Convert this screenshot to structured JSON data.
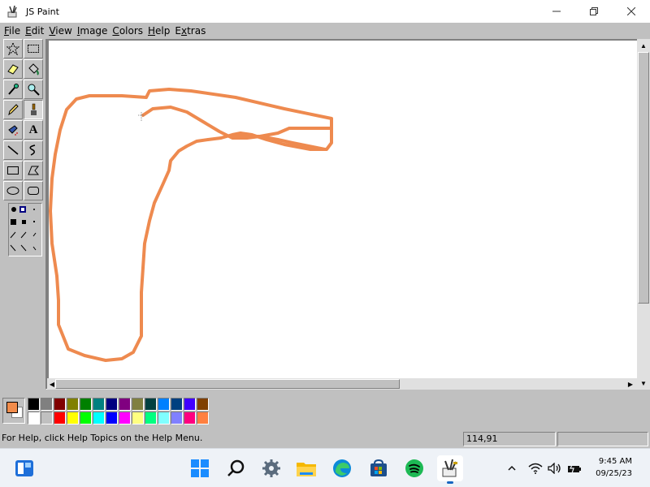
{
  "window": {
    "title": "JS Paint",
    "minimize_icon": "minimize-icon",
    "maximize_icon": "restore-icon",
    "close_icon": "close-icon"
  },
  "menu": [
    {
      "label": "File",
      "mnemonic": "F",
      "rest": "ile"
    },
    {
      "label": "Edit",
      "mnemonic": "E",
      "rest": "dit"
    },
    {
      "label": "View",
      "mnemonic": "V",
      "rest": "iew"
    },
    {
      "label": "Image",
      "mnemonic": "I",
      "rest": "mage"
    },
    {
      "label": "Colors",
      "mnemonic": "C",
      "rest": "olors"
    },
    {
      "label": "Help",
      "mnemonic": "H",
      "rest": "elp"
    },
    {
      "label": "Extras",
      "mnemonic": "x",
      "prefix": "E",
      "rest": "tras"
    }
  ],
  "tools": [
    {
      "name": "free-form-select",
      "icon": "star-select-icon"
    },
    {
      "name": "select",
      "icon": "rect-select-icon"
    },
    {
      "name": "eraser",
      "icon": "eraser-icon"
    },
    {
      "name": "fill-with-color",
      "icon": "paint-bucket-icon"
    },
    {
      "name": "pick-color",
      "icon": "eyedropper-icon"
    },
    {
      "name": "magnifier",
      "icon": "magnifier-icon"
    },
    {
      "name": "pencil",
      "icon": "pencil-icon"
    },
    {
      "name": "brush",
      "icon": "brush-icon",
      "selected": true
    },
    {
      "name": "airbrush",
      "icon": "airbrush-icon"
    },
    {
      "name": "text",
      "icon": "text-icon",
      "glyph": "A"
    },
    {
      "name": "line",
      "icon": "line-icon"
    },
    {
      "name": "curve",
      "icon": "curve-icon"
    },
    {
      "name": "rectangle",
      "icon": "rectangle-icon"
    },
    {
      "name": "polygon",
      "icon": "polygon-icon"
    },
    {
      "name": "ellipse",
      "icon": "ellipse-icon"
    },
    {
      "name": "rounded-rectangle",
      "icon": "rounded-rectangle-icon"
    }
  ],
  "palette": {
    "foreground": "#f28c4b",
    "background": "#ffffff",
    "colors_row1": [
      "#000000",
      "#808080",
      "#800000",
      "#808000",
      "#008000",
      "#008080",
      "#000080",
      "#800080",
      "#808040",
      "#004040",
      "#0080ff",
      "#004080",
      "#4000ff",
      "#804000"
    ],
    "colors_row2": [
      "#ffffff",
      "#c0c0c0",
      "#ff0000",
      "#ffff00",
      "#00ff00",
      "#00ffff",
      "#0000ff",
      "#ff00ff",
      "#ffff80",
      "#00ff80",
      "#80ffff",
      "#8080ff",
      "#ff0080",
      "#ff8040"
    ]
  },
  "status": {
    "help_text": "For Help, click Help Topics on the Help Menu.",
    "coordinates": "114,91"
  },
  "drawing": {
    "stroke_color": "#ee8a4f"
  },
  "taskbar": {
    "icons": [
      "widgets-icon",
      "windows-start-icon",
      "search-icon",
      "settings-icon",
      "file-explorer-icon",
      "edge-icon",
      "store-icon",
      "spotify-icon",
      "jspaint-icon"
    ],
    "active": "jspaint-icon"
  },
  "tray": {
    "chevron_icon": "chevron-up-icon",
    "wifi_icon": "wifi-icon",
    "volume_icon": "volume-icon",
    "battery_icon": "battery-icon",
    "time": "9:45 AM",
    "date": "09/25/23"
  }
}
